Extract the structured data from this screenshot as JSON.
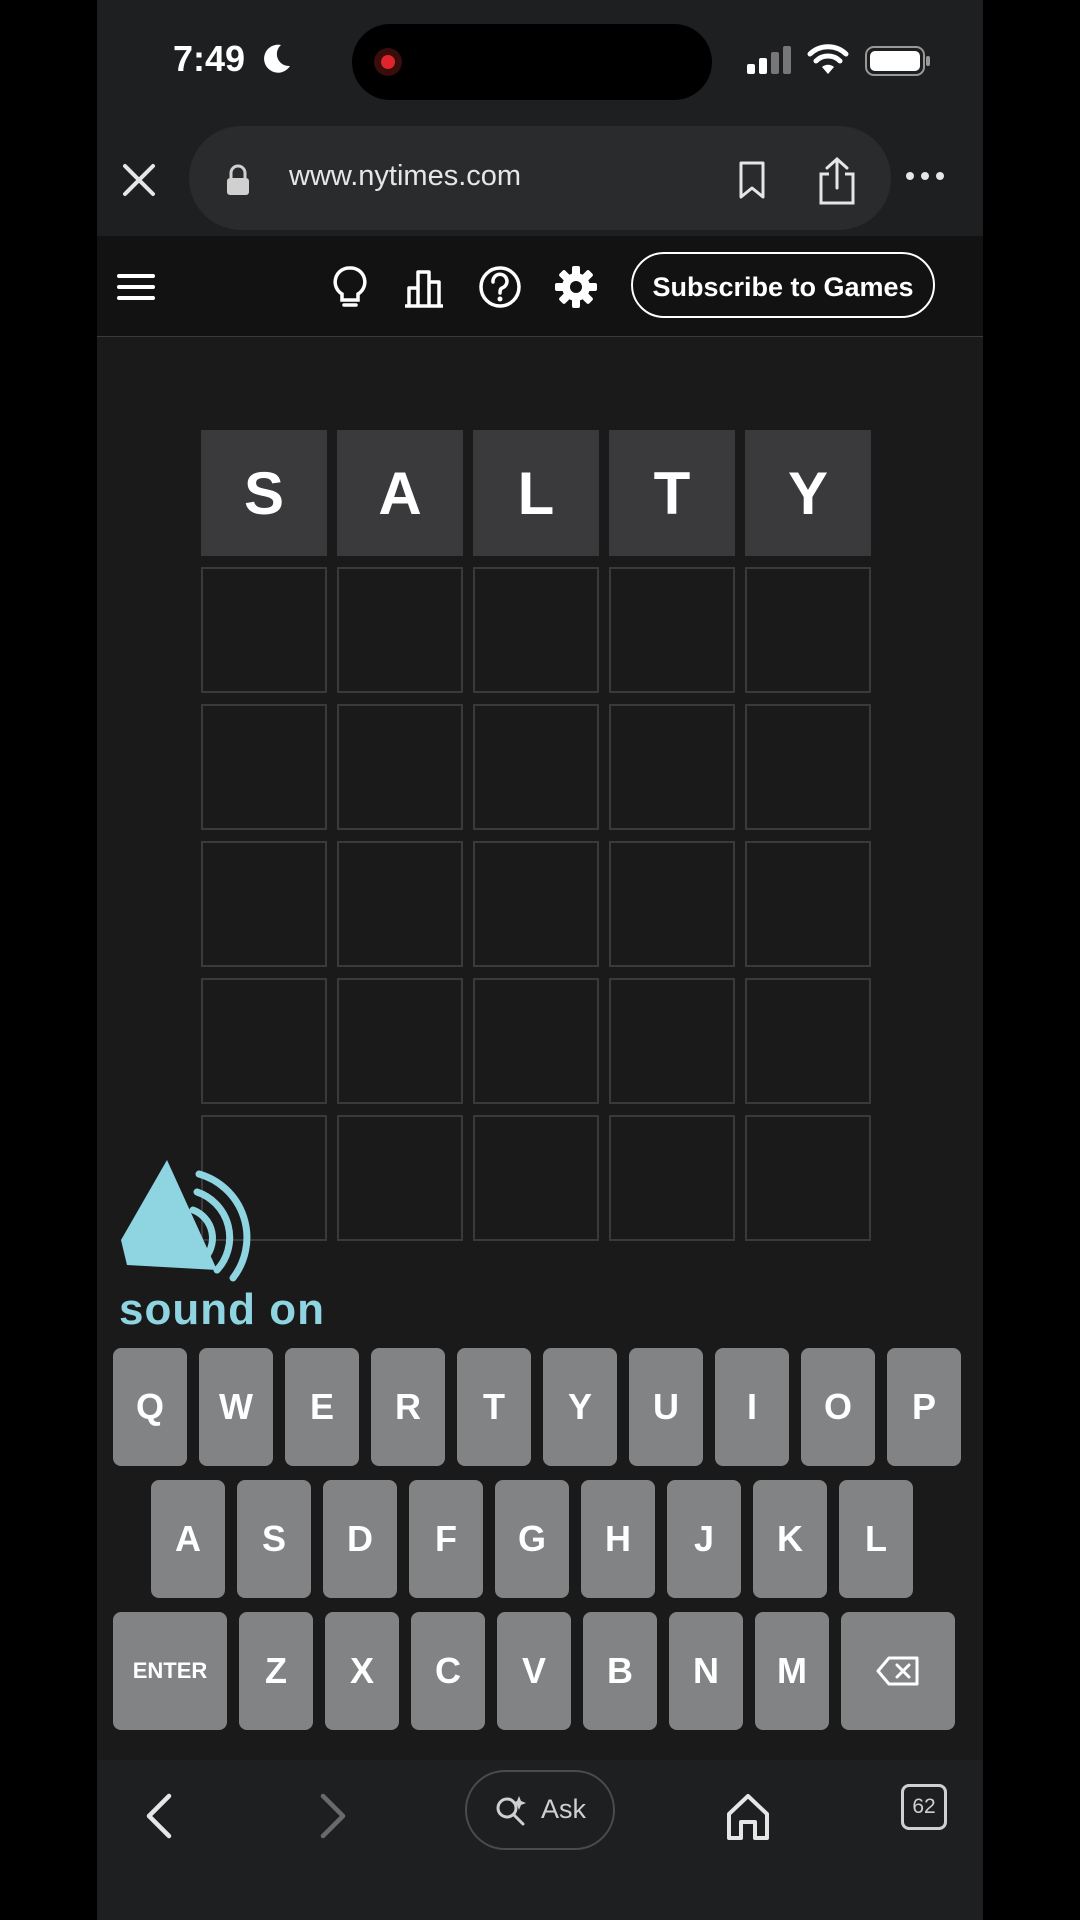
{
  "status_bar": {
    "time": "7:49"
  },
  "browser": {
    "url": "www.nytimes.com",
    "icons": [
      "close-icon",
      "lock-icon",
      "bookmark-icon",
      "share-icon",
      "more-icon"
    ]
  },
  "game_header": {
    "subscribe_label": "Subscribe to Games",
    "icons": [
      "menu-icon",
      "hint-bulb-icon",
      "stats-icon",
      "help-icon",
      "settings-gear-icon"
    ]
  },
  "board": {
    "rows": [
      [
        "S",
        "A",
        "L",
        "T",
        "Y"
      ],
      [
        "",
        "",
        "",
        "",
        ""
      ],
      [
        "",
        "",
        "",
        "",
        ""
      ],
      [
        "",
        "",
        "",
        "",
        ""
      ],
      [
        "",
        "",
        "",
        "",
        ""
      ],
      [
        "",
        "",
        "",
        "",
        ""
      ]
    ]
  },
  "overlay": {
    "sound_text": "sound on",
    "sound_color": "#8fd4e1"
  },
  "keyboard": {
    "row1": [
      "Q",
      "W",
      "E",
      "R",
      "T",
      "Y",
      "U",
      "I",
      "O",
      "P"
    ],
    "row2": [
      "A",
      "S",
      "D",
      "F",
      "G",
      "H",
      "J",
      "K",
      "L"
    ],
    "row3": [
      "ENTER",
      "Z",
      "X",
      "C",
      "V",
      "B",
      "N",
      "M"
    ],
    "backspace_icon": "backspace-icon"
  },
  "bottom_nav": {
    "ask_label": "Ask",
    "tab_count": "62",
    "icons": [
      "back-icon",
      "forward-icon",
      "ask-sparkle-icon",
      "home-icon",
      "tabs-icon"
    ]
  },
  "colors": {
    "background": "#1a1a1b",
    "tile_filled": "#3a3a3c",
    "key": "#818384"
  }
}
